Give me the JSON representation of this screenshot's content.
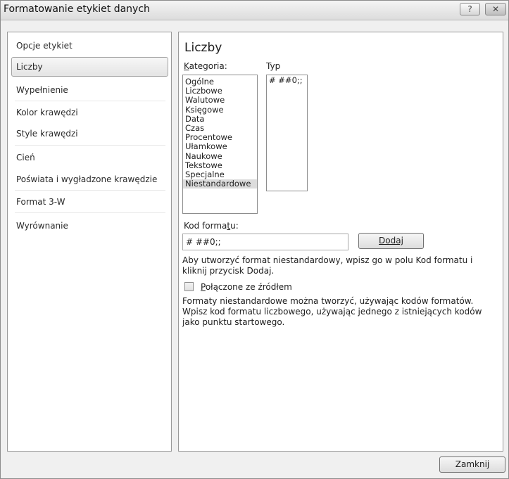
{
  "window": {
    "title": "Formatowanie etykiet danych",
    "help_glyph": "?",
    "close_glyph": "✕"
  },
  "nav": {
    "items": [
      {
        "label": "Opcje etykiet"
      },
      {
        "label": "Liczby",
        "selected": true
      },
      {
        "label": "Wypełnienie"
      },
      {
        "label": "Kolor krawędzi"
      },
      {
        "label": "Style krawędzi"
      },
      {
        "label": "Cień"
      },
      {
        "label": "Poświata i wygładzone krawędzie"
      },
      {
        "label": "Format 3-W"
      },
      {
        "label": "Wyrównanie"
      }
    ]
  },
  "main": {
    "heading": "Liczby",
    "category_label_first": "K",
    "category_label_rest": "ategoria:",
    "type_label": "Typ",
    "categories": [
      "Ogólne",
      "Liczbowe",
      "Walutowe",
      "Księgowe",
      "Data",
      "Czas",
      "Procentowe",
      "Ułamkowe",
      "Naukowe",
      "Tekstowe",
      "Specjalne",
      "Niestandardowe"
    ],
    "selected_category": "Niestandardowe",
    "types": [
      "# ##0;;"
    ],
    "format_code_label_pre": "Kod forma",
    "format_code_label_u": "t",
    "format_code_label_post": "u:",
    "format_code_value": "# ##0;;",
    "add_button_label": "Dodaj",
    "hint_line1": "Aby utworzyć format niestandardowy, wpisz go w polu Kod formatu i",
    "hint_line2": "kliknij przycisk Dodaj.",
    "linked_checkbox_label_u": "P",
    "linked_checkbox_label_rest": "ołączone ze źródłem",
    "linked_checked": false,
    "info_line1": "Formaty niestandardowe można tworzyć, używając kodów formatów.",
    "info_line2": "Wpisz kod formatu liczbowego, używając jednego z istniejących kodów",
    "info_line3": "jako punktu startowego."
  },
  "footer": {
    "close_button_label": "Zamknij"
  }
}
